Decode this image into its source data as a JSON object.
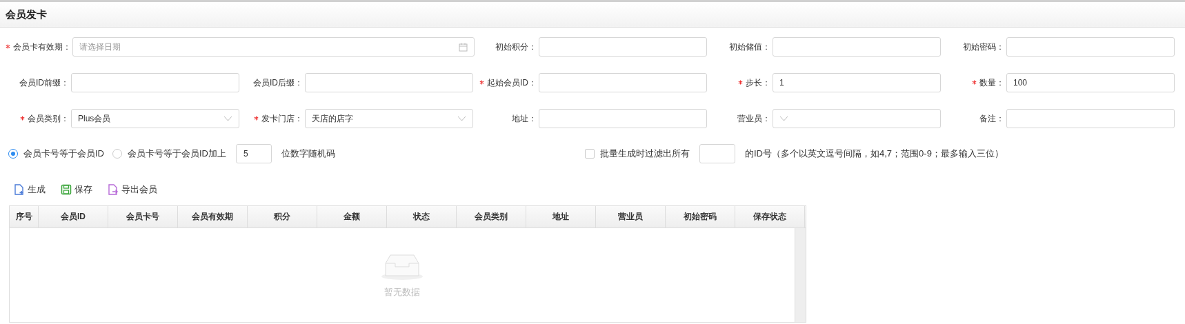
{
  "title": "会员发卡",
  "form": {
    "fields": [
      {
        "kind": "date",
        "label": "会员卡有效期：",
        "required": true,
        "placeholder": "请选择日期",
        "wide": true
      },
      {
        "kind": "text",
        "label": "初始积分：",
        "required": false
      },
      {
        "kind": "text",
        "label": "初始储值：",
        "required": false
      },
      {
        "kind": "text",
        "label": "初始密码：",
        "required": false
      },
      {
        "kind": "text",
        "label": "会员ID前缀：",
        "required": false
      },
      {
        "kind": "text",
        "label": "会员ID后缀：",
        "required": false
      },
      {
        "kind": "text",
        "label": "起始会员ID：",
        "required": true
      },
      {
        "kind": "text",
        "label": "步长：",
        "required": true,
        "value": "1"
      },
      {
        "kind": "text",
        "label": "数量：",
        "required": true,
        "value": "100"
      },
      {
        "kind": "select",
        "label": "会员类别：",
        "required": true,
        "value": "Plus会员"
      },
      {
        "kind": "select",
        "label": "发卡门店：",
        "required": true,
        "value": "天店的店字"
      },
      {
        "kind": "text",
        "label": "地址：",
        "required": false
      },
      {
        "kind": "select",
        "label": "营业员：",
        "required": false
      },
      {
        "kind": "text",
        "label": "备注：",
        "required": false
      }
    ]
  },
  "card_number_options": [
    {
      "label": "会员卡号等于会员ID",
      "selected": true
    },
    {
      "label": "会员卡号等于会员ID加上",
      "selected": false,
      "digits": "5",
      "suffix": "位数字随机码"
    }
  ],
  "filter": {
    "checked": false,
    "label": "批量生成时过滤出所有",
    "suffix": "的ID号（多个以英文逗号间隔，如4,7；范围0-9；最多输入三位）"
  },
  "toolbar": [
    {
      "kind": "generate",
      "label": "生成"
    },
    {
      "kind": "save",
      "label": "保存"
    },
    {
      "kind": "export",
      "label": "导出会员"
    }
  ],
  "table": {
    "columns": [
      "序号",
      "会员ID",
      "会员卡号",
      "会员有效期",
      "积分",
      "金额",
      "状态",
      "会员类别",
      "地址",
      "营业员",
      "初始密码",
      "保存状态"
    ],
    "empty_text": "暂无数据"
  }
}
